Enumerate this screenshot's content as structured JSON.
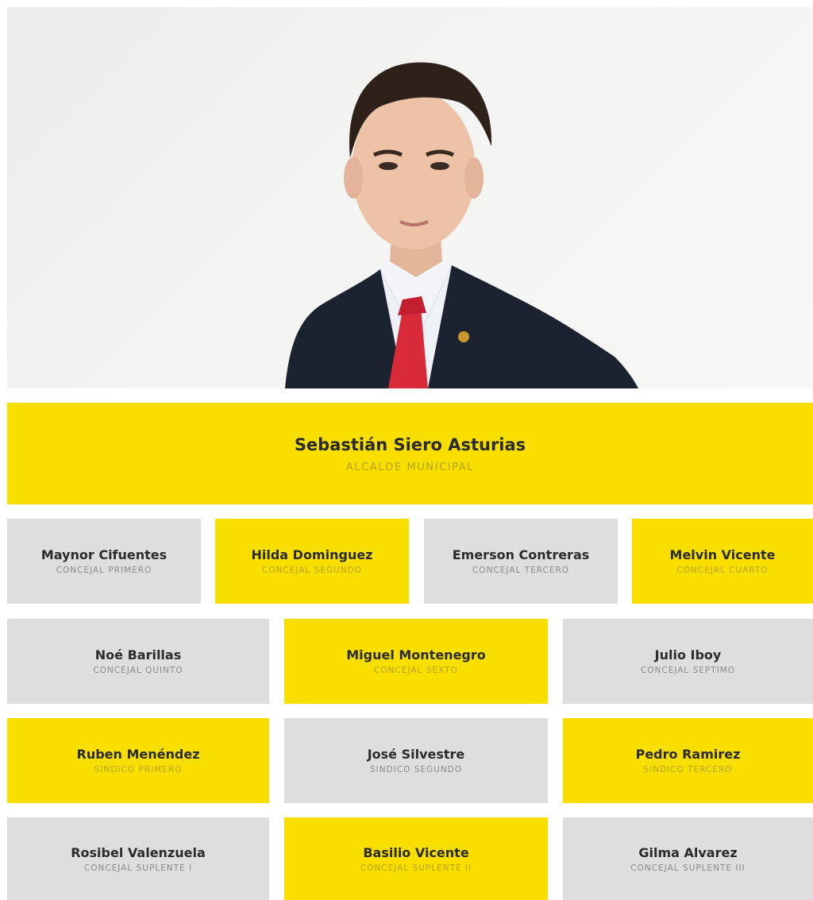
{
  "mayor": {
    "name": "Sebastián Siero Asturias",
    "role": "ALCALDE MUNICIPAL"
  },
  "rows": [
    [
      {
        "name": "Maynor Cifuentes",
        "role": "CONCEJAL PRIMERO",
        "color": "grey"
      },
      {
        "name": "Hilda Dominguez",
        "role": "CONCEJAL SEGUNDO",
        "color": "yellow"
      },
      {
        "name": "Emerson Contreras",
        "role": "CONCEJAL TERCERO",
        "color": "grey"
      },
      {
        "name": "Melvin Vicente",
        "role": "CONCEJAL CUARTO",
        "color": "yellow"
      }
    ],
    [
      {
        "name": "Noé Barillas",
        "role": "CONCEJAL QUINTO",
        "color": "grey"
      },
      {
        "name": "Miguel Montenegro",
        "role": "CONCEJAL SEXTO",
        "color": "yellow"
      },
      {
        "name": "Julio Iboy",
        "role": "CONCEJAL SEPTIMO",
        "color": "grey"
      }
    ],
    [
      {
        "name": "Ruben Menéndez",
        "role": "SINDICO PRIMERO",
        "color": "yellow"
      },
      {
        "name": "José Silvestre",
        "role": "SINDICO SEGUNDO",
        "color": "grey"
      },
      {
        "name": "Pedro Ramirez",
        "role": "SINDICO TERCERO",
        "color": "yellow"
      }
    ],
    [
      {
        "name": "Rosibel Valenzuela",
        "role": "CONCEJAL SUPLENTE I",
        "color": "grey"
      },
      {
        "name": "Basilio Vicente",
        "role": "CONCEJAL SUPLENTE II",
        "color": "yellow"
      },
      {
        "name": "Gilma Alvarez",
        "role": "CONCEJAL SUPLENTE III",
        "color": "grey"
      }
    ]
  ],
  "colors": {
    "yellow": "#f9df00",
    "grey": "#dedede"
  }
}
